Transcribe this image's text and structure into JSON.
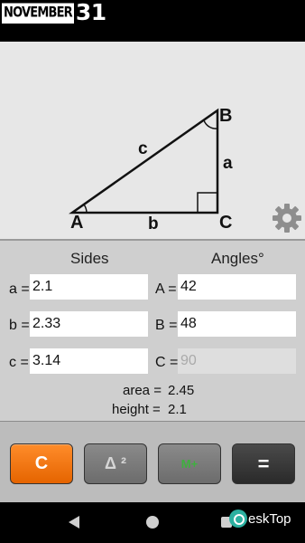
{
  "header": {
    "logo_month": "NOVEMBER",
    "logo_day": "31"
  },
  "diagram": {
    "vertex_a": "A",
    "vertex_b": "B",
    "vertex_c": "C",
    "side_a": "a",
    "side_b": "b",
    "side_c": "c",
    "settings_icon": "gear-icon"
  },
  "form": {
    "sides_header": "Sides",
    "angles_header": "Angles°",
    "sides": [
      {
        "label": "a =",
        "value": "2.1"
      },
      {
        "label": "b =",
        "value": "2.33"
      },
      {
        "label": "c =",
        "value": "3.14"
      }
    ],
    "angles": [
      {
        "label": "A =",
        "value": "42"
      },
      {
        "label": "B =",
        "value": "48"
      },
      {
        "label": "C =",
        "value": "90"
      }
    ],
    "area_label": "area =",
    "area_value": "2.45",
    "height_label": "height =",
    "height_value": "2.1"
  },
  "buttons": {
    "clear_label": "C",
    "square_label": "Δ ²",
    "memory_label": "M+",
    "equals_label": "="
  },
  "watermark": {
    "text": "eskTop"
  },
  "colors": {
    "clear_button": "#ff7a10",
    "memory_text": "#3fb03f",
    "diagram_bg": "#e7e7e7",
    "form_bg": "#cfcfcf"
  }
}
